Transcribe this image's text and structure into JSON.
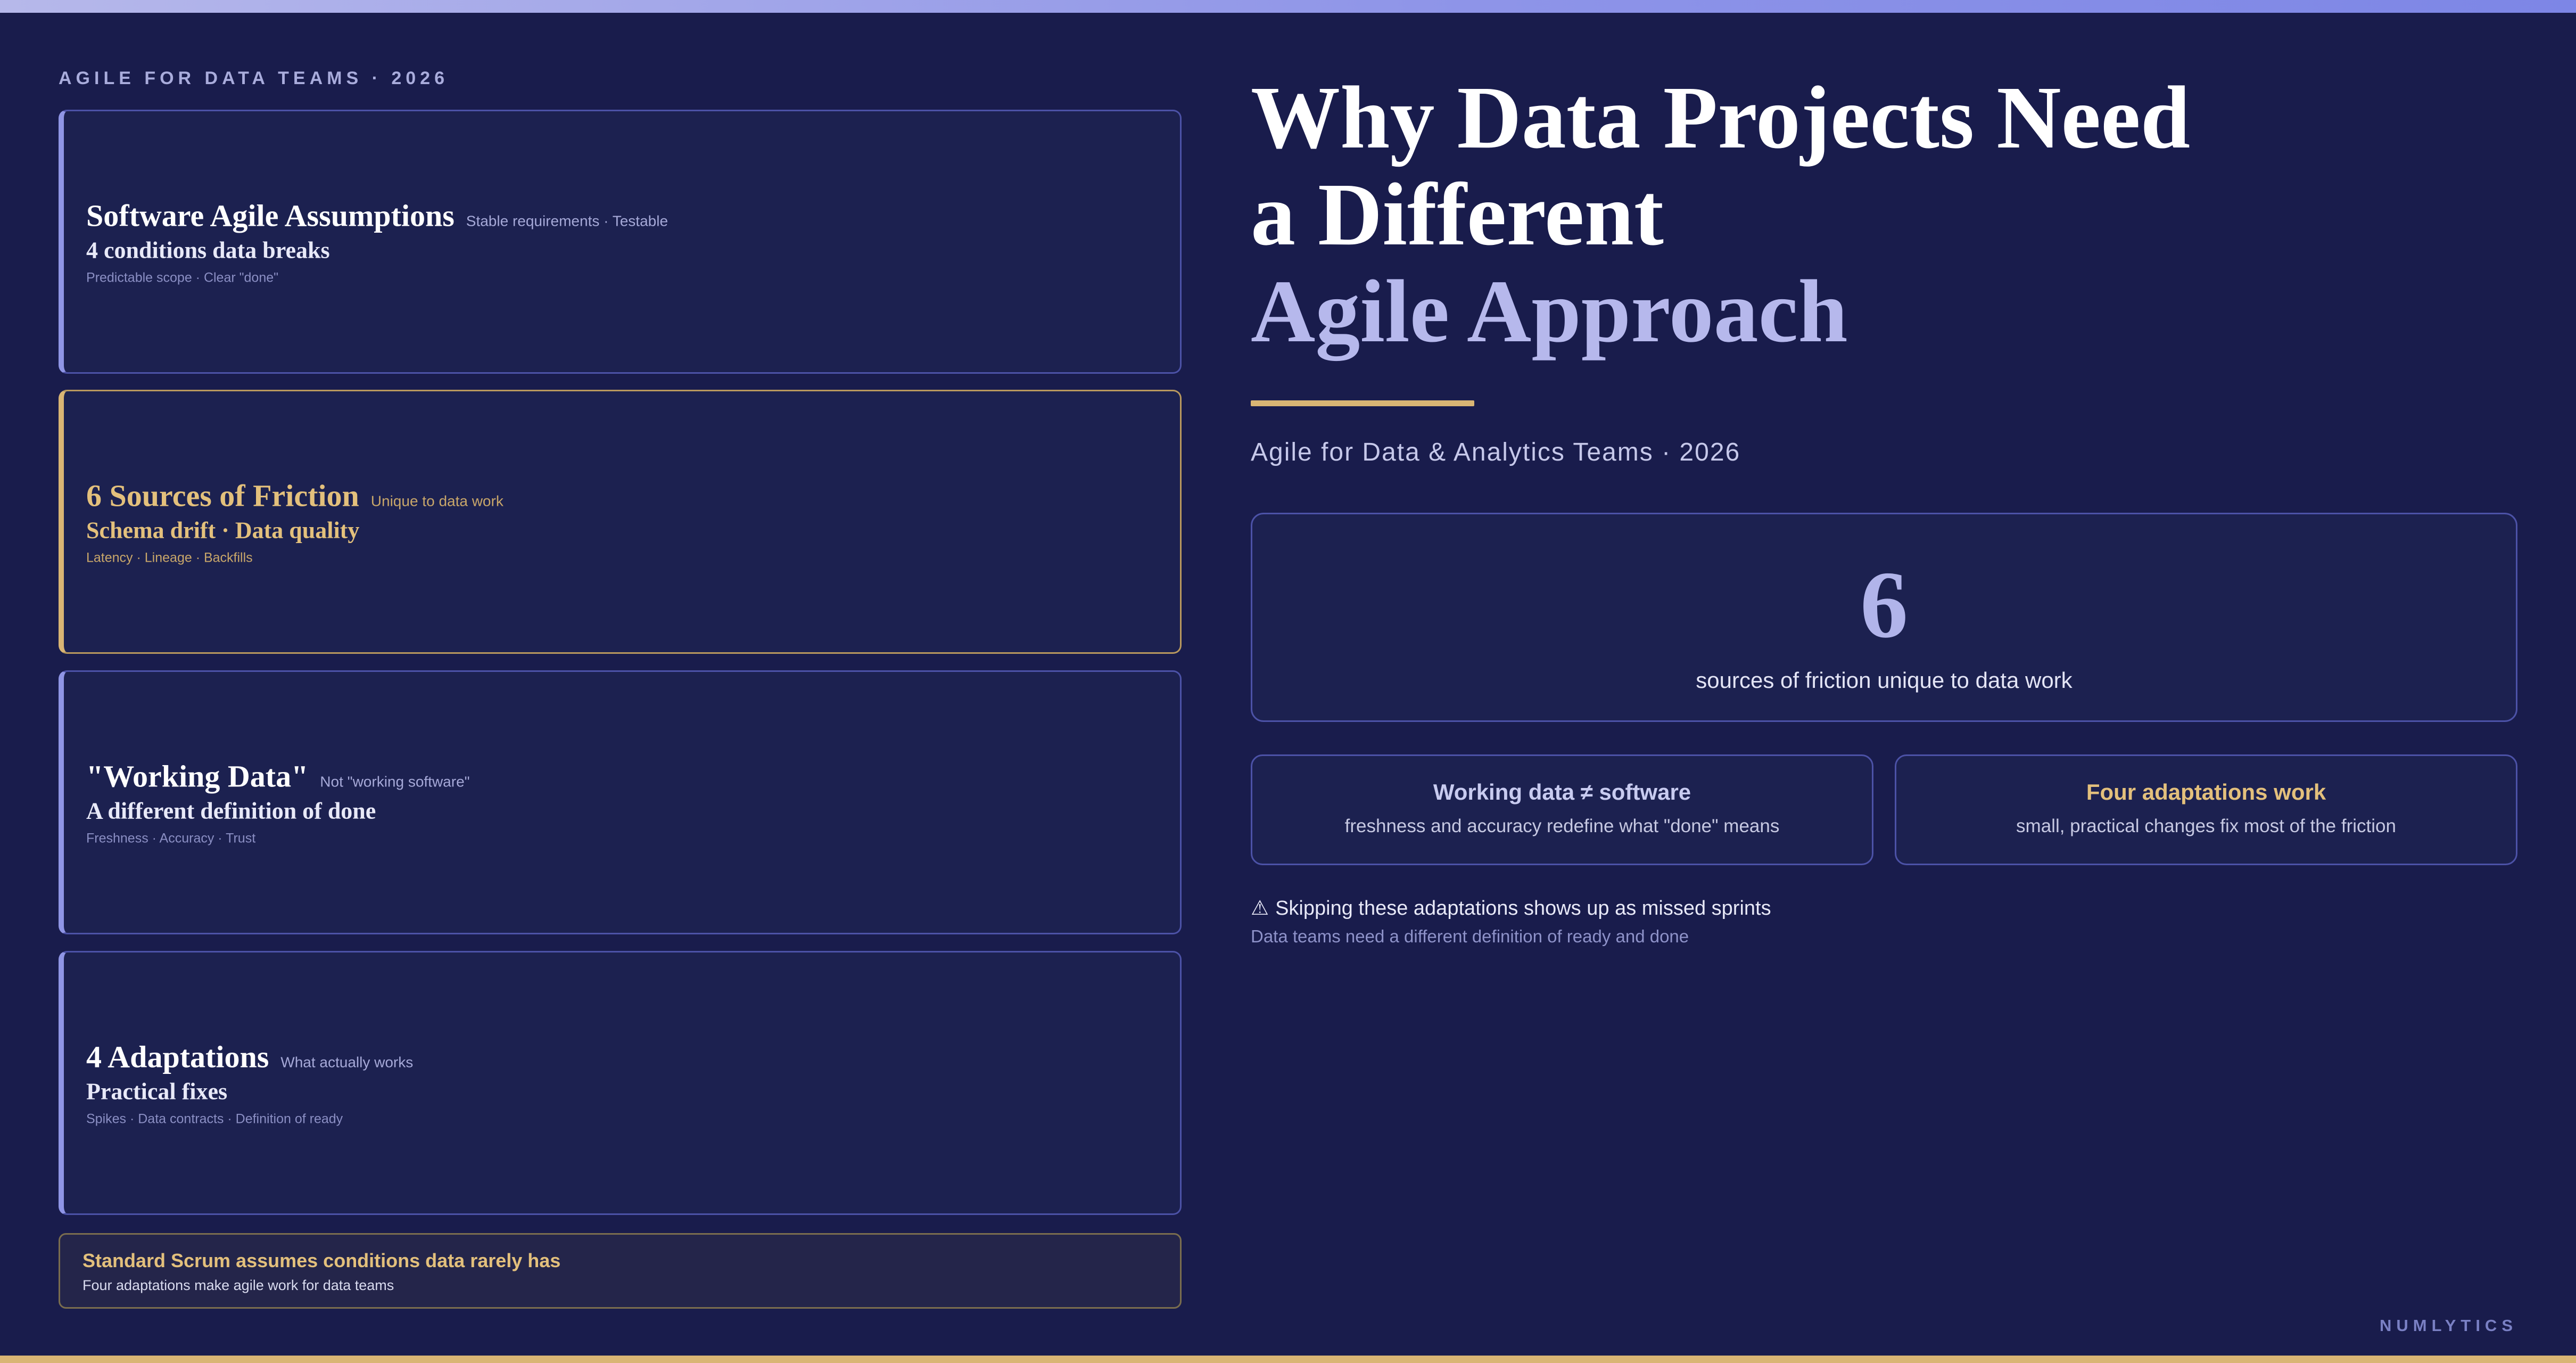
{
  "kicker": "AGILE FOR DATA TEAMS · 2026",
  "cards": [
    {
      "title": "Software Agile Assumptions",
      "tag": "Stable requirements · Testable",
      "sub": "4 conditions data breaks",
      "meta": "Predictable scope · Clear \"done\""
    },
    {
      "title": "6 Sources of Friction",
      "tag": "Unique to data work",
      "sub": "Schema drift · Data quality",
      "meta": "Latency · Lineage · Backfills"
    },
    {
      "title": "\"Working Data\"",
      "tag": "Not \"working software\"",
      "sub": "A different definition of done",
      "meta": "Freshness · Accuracy · Trust"
    },
    {
      "title": "4 Adaptations",
      "tag": "What actually works",
      "sub": "Practical fixes",
      "meta": "Spikes · Data contracts · Definition of ready"
    }
  ],
  "note": {
    "heading": "Standard Scrum assumes conditions data rarely has",
    "text": "Four adaptations make agile work for data teams"
  },
  "headline": {
    "line1": "Why Data Projects Need",
    "line2": "a Different",
    "line3": "Agile Approach"
  },
  "subtitle": "Agile for Data & Analytics Teams · 2026",
  "stat": {
    "number": "6",
    "label": "sources of friction unique to data work"
  },
  "minis": [
    {
      "title": "Working data ≠ software",
      "text": "freshness and accuracy redefine what \"done\" means"
    },
    {
      "title": "Four adaptations work",
      "text": "small, practical changes fix most of the friction"
    }
  ],
  "warning": {
    "icon": "⚠",
    "text": "Skipping these adaptations shows up as missed sprints",
    "sub": "Data teams need a different definition of ready and done"
  },
  "brand": "NUMLYTICS",
  "colors": {
    "background": "#191c4c",
    "accent_lavender": "#b6b8ec",
    "accent_gold": "#d9b574",
    "card": "#1c2150"
  }
}
